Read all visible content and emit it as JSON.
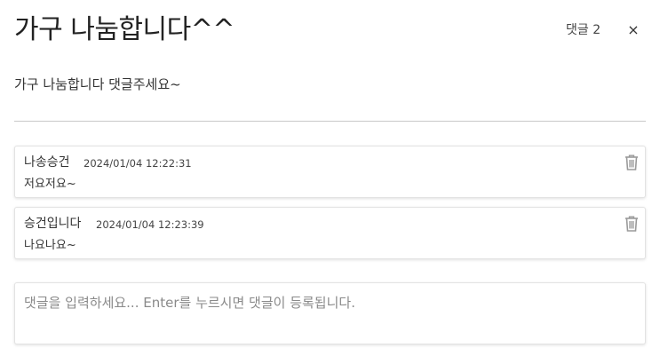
{
  "post": {
    "title": "가구 나눔합니다^^",
    "body": "가구 나눔합니다 댓글주세요~",
    "comment_count_label": "댓글 2",
    "close_label": "×"
  },
  "comments": [
    {
      "author": "나송승건",
      "timestamp": "2024/01/04 12:22:31",
      "text": "저요저요~",
      "delete_icon": "trash-icon"
    },
    {
      "author": "승건입니다",
      "timestamp": "2024/01/04 12:23:39",
      "text": "나요나요~",
      "delete_icon": "trash-icon"
    }
  ],
  "comment_input": {
    "value": "",
    "placeholder": "댓글을 입력하세요... Enter를 누르시면 댓글이 등록됩니다."
  },
  "colors": {
    "divider": "#c8c8c8",
    "icon_gray": "#9a9a9a"
  }
}
